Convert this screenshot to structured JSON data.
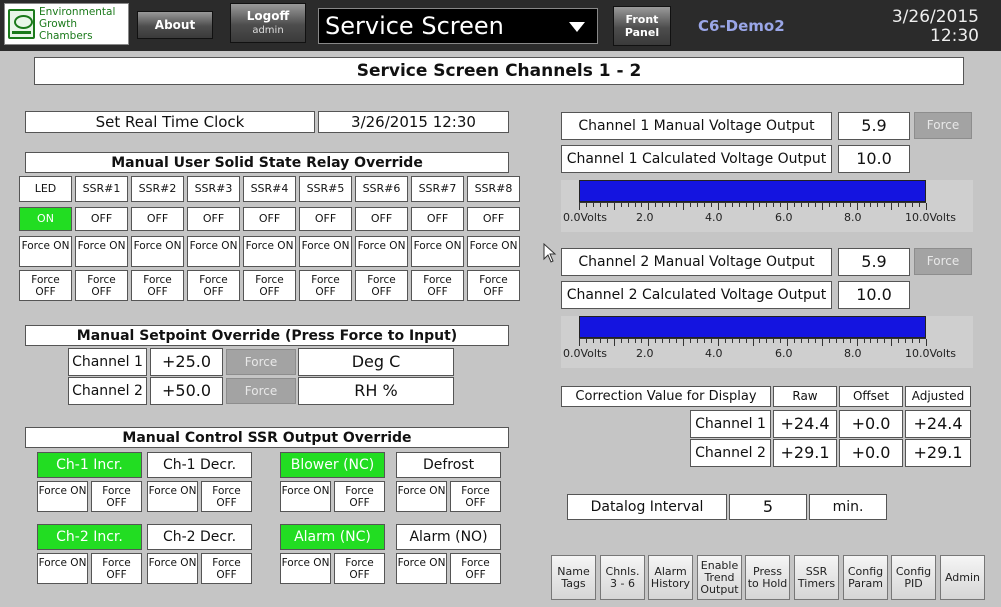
{
  "header": {
    "logo_lines": [
      "Environmental",
      "Growth",
      "Chambers"
    ],
    "about_label": "About",
    "logoff_label": "Logoff",
    "user": "admin",
    "screen_selector": "Service Screen",
    "front_panel": [
      "Front",
      "Panel"
    ],
    "device_name": "C6-Demo2",
    "date": "3/26/2015",
    "time": "12:30"
  },
  "page_title": "Service Screen Channels 1 - 2",
  "clock": {
    "label": "Set Real Time Clock",
    "value": "3/26/2015 12:30"
  },
  "ssr_override": {
    "title": "Manual User Solid State Relay Override",
    "columns": [
      {
        "label": "LED",
        "state": "ON",
        "on": true
      },
      {
        "label": "SSR#1",
        "state": "OFF",
        "on": false
      },
      {
        "label": "SSR#2",
        "state": "OFF",
        "on": false
      },
      {
        "label": "SSR#3",
        "state": "OFF",
        "on": false
      },
      {
        "label": "SSR#4",
        "state": "OFF",
        "on": false
      },
      {
        "label": "SSR#5",
        "state": "OFF",
        "on": false
      },
      {
        "label": "SSR#6",
        "state": "OFF",
        "on": false
      },
      {
        "label": "SSR#7",
        "state": "OFF",
        "on": false
      },
      {
        "label": "SSR#8",
        "state": "OFF",
        "on": false
      }
    ],
    "force_on": "Force ON",
    "force_off": "Force OFF"
  },
  "setpoint_override": {
    "title": "Manual Setpoint Override   (Press Force to Input)",
    "rows": [
      {
        "channel": "Channel 1",
        "value": "+25.0",
        "force": "Force",
        "unit": "Deg C"
      },
      {
        "channel": "Channel 2",
        "value": "+50.0",
        "force": "Force",
        "unit": "RH %"
      }
    ]
  },
  "ssr_output": {
    "title": "Manual Control SSR Output Override",
    "items": [
      {
        "label": "Ch-1 Incr.",
        "on": true
      },
      {
        "label": "Ch-1 Decr.",
        "on": false
      },
      {
        "label": "Blower (NC)",
        "on": true
      },
      {
        "label": "Defrost",
        "on": false
      },
      {
        "label": "Ch-2 Incr.",
        "on": true
      },
      {
        "label": "Ch-2 Decr.",
        "on": false
      },
      {
        "label": "Alarm (NC)",
        "on": true
      },
      {
        "label": "Alarm (NO)",
        "on": false
      }
    ],
    "force_on": "Force ON",
    "force_off": "Force OFF"
  },
  "channels": [
    {
      "manual_label": "Channel 1 Manual Voltage Output",
      "manual_value": "5.9",
      "force": "Force",
      "calc_label": "Channel 1 Calculated Voltage Output",
      "calc_value": "10.0",
      "bar_level": 1.0
    },
    {
      "manual_label": "Channel 2 Manual Voltage Output",
      "manual_value": "5.9",
      "force": "Force",
      "calc_label": "Channel 2 Calculated Voltage Output",
      "calc_value": "10.0",
      "bar_level": 1.0
    }
  ],
  "bar_scale": [
    "0.0Volts",
    "2.0",
    "4.0",
    "6.0",
    "8.0",
    "10.0Volts"
  ],
  "correction": {
    "label": "Correction Value for Display",
    "headers": [
      "Raw",
      "Offset",
      "Adjusted"
    ],
    "rows": [
      {
        "channel": "Channel 1",
        "raw": "+24.4",
        "offset": "+0.0",
        "adjusted": "+24.4"
      },
      {
        "channel": "Channel 2",
        "raw": "+29.1",
        "offset": "+0.0",
        "adjusted": "+29.1"
      }
    ]
  },
  "datalog": {
    "label": "Datalog Interval",
    "value": "5",
    "unit": "min."
  },
  "nav_buttons": [
    "Name Tags",
    "Chnls. 3 - 6",
    "Alarm History",
    "Enable Trend Output",
    "Press to Hold",
    "SSR Timers",
    "Config Param",
    "Config PID",
    "Admin"
  ],
  "colors": {
    "on_green": "#22dd22",
    "bar_blue": "#1414e0",
    "topbar": "#2b2b2b"
  }
}
